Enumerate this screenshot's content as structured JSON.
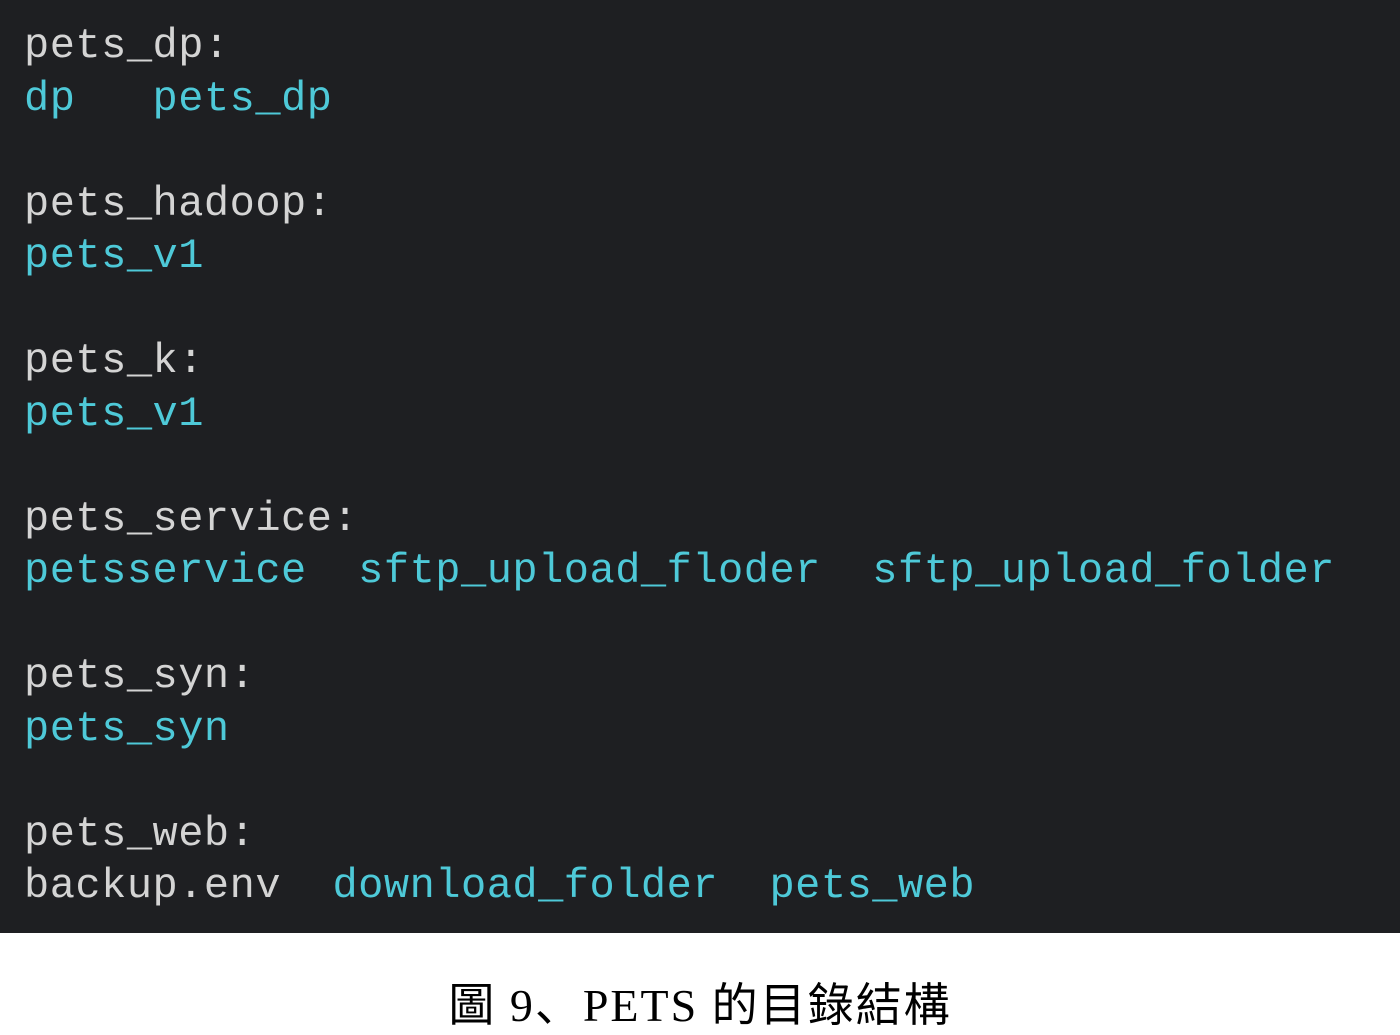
{
  "terminal": {
    "groups": [
      {
        "header": "pets_dp:",
        "entries": [
          {
            "name": "dp",
            "type": "dir"
          },
          {
            "name": "pets_dp",
            "type": "dir"
          }
        ]
      },
      {
        "header": "pets_hadoop:",
        "entries": [
          {
            "name": "pets_v1",
            "type": "dir"
          }
        ]
      },
      {
        "header": "pets_k:",
        "entries": [
          {
            "name": "pets_v1",
            "type": "dir"
          }
        ]
      },
      {
        "header": "pets_service:",
        "entries": [
          {
            "name": "petsservice",
            "type": "dir"
          },
          {
            "name": "sftp_upload_floder",
            "type": "dir"
          },
          {
            "name": "sftp_upload_folder",
            "type": "dir"
          }
        ]
      },
      {
        "header": "pets_syn:",
        "entries": [
          {
            "name": "pets_syn",
            "type": "dir"
          }
        ]
      },
      {
        "header": "pets_web:",
        "entries": [
          {
            "name": "backup.env",
            "type": "plain"
          },
          {
            "name": "download_folder",
            "type": "dir"
          },
          {
            "name": "pets_web",
            "type": "dir"
          }
        ]
      }
    ]
  },
  "caption": "圖 9、PETS 的目錄結構"
}
